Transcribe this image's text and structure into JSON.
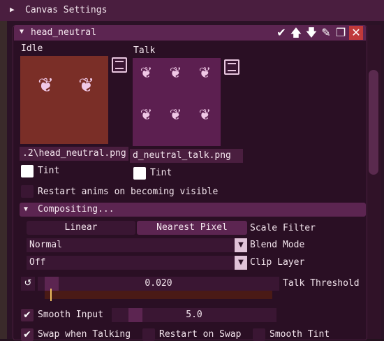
{
  "canvas_settings": {
    "title": "Canvas Settings"
  },
  "layer": {
    "name": "head_neutral",
    "idle": {
      "label": "Idle",
      "path": ".2\\head_neutral.png",
      "tint_label": "Tint"
    },
    "talk": {
      "label": "Talk",
      "path": "d_neutral_talk.png",
      "tint_label": "Tint"
    },
    "restart_anims_label": "Restart anims on becoming visible"
  },
  "compositing": {
    "title": "Compositing...",
    "scale_filter": {
      "options": [
        "Linear",
        "Nearest Pixel"
      ],
      "selected": "Nearest Pixel",
      "label": "Scale Filter"
    },
    "blend_mode": {
      "value": "Normal",
      "label": "Blend Mode"
    },
    "clip_layer": {
      "value": "Off",
      "label": "Clip Layer"
    }
  },
  "talk_threshold": {
    "value": "0.020",
    "label": "Talk Threshold",
    "level": 0.03
  },
  "smooth_input": {
    "label": "Smooth Input",
    "value": "5.0",
    "checked": true
  },
  "bottom_row": {
    "swap_when_talking": "Swap when Talking",
    "restart_on_swap": "Restart on Swap",
    "smooth_tint": "Smooth Tint"
  },
  "icons": {
    "expand": "triangle-right-icon",
    "collapse": "triangle-down-icon",
    "tools": [
      "check-icon",
      "arrow-up-icon",
      "arrow-down-icon",
      "pencil-icon",
      "copy-icon",
      "close-icon"
    ],
    "film": "film-icon",
    "reset": "reset-icon"
  },
  "colors": {
    "accent": "#5c2551",
    "close": "#c03a3a",
    "idle_bg": "#7a2e27",
    "talk_bg": "#5c1f50"
  }
}
